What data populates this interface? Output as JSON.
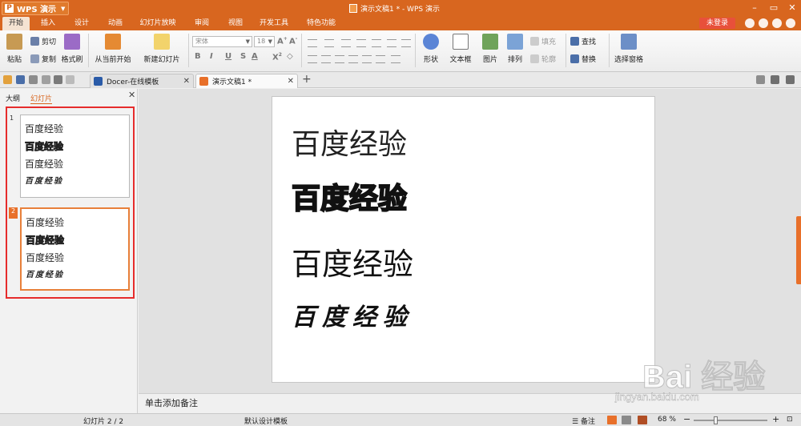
{
  "title_bar": {
    "app_name": "WPS 演示",
    "app_logo": "P",
    "window_title": "演示文稿1 * - WPS 演示",
    "colors": {
      "accent": "#d8661f",
      "login": "#e8503a"
    }
  },
  "menu": {
    "tabs": [
      "开始",
      "插入",
      "设计",
      "动画",
      "幻灯片放映",
      "审阅",
      "视图",
      "开发工具",
      "特色功能"
    ],
    "login": "未登录"
  },
  "ribbon": {
    "paste": "粘贴",
    "cut": "剪切",
    "copy": "复制",
    "format_painter": "格式刷",
    "from_current": "从当前开始",
    "new_slide": "新建幻灯片",
    "font_name": "宋体",
    "font_size": "18",
    "shape": "形状",
    "textbox": "文本框",
    "picture": "图片",
    "arrange": "排列",
    "fill": "填充",
    "outline": "轮廓",
    "find": "查找",
    "replace": "替换",
    "selection_pane": "选择窗格"
  },
  "doc_tabs": [
    {
      "label": "Docer-在线模板"
    },
    {
      "label": "演示文稿1 *"
    }
  ],
  "side_panel": {
    "tab_outline": "大纲",
    "tab_slides": "幻灯片"
  },
  "slides": [
    {
      "num": "1",
      "lines": [
        "百度经验",
        "百度经验",
        "百度经验",
        "百度经验"
      ]
    },
    {
      "num": "2",
      "lines": [
        "百度经验",
        "百度经验",
        "百度经验",
        "百度经验"
      ]
    }
  ],
  "main_slide": {
    "lines": [
      "百度经验",
      "百度经验",
      "百度经验",
      "百度经验"
    ]
  },
  "notes_placeholder": "单击添加备注",
  "status": {
    "slide_counter": "幻灯片 2 / 2",
    "template": "默认设计模板",
    "notes": "备注",
    "zoom": "68 %"
  },
  "watermark": {
    "brand": "Bai 经验",
    "url": "jingyan.baidu.com"
  }
}
